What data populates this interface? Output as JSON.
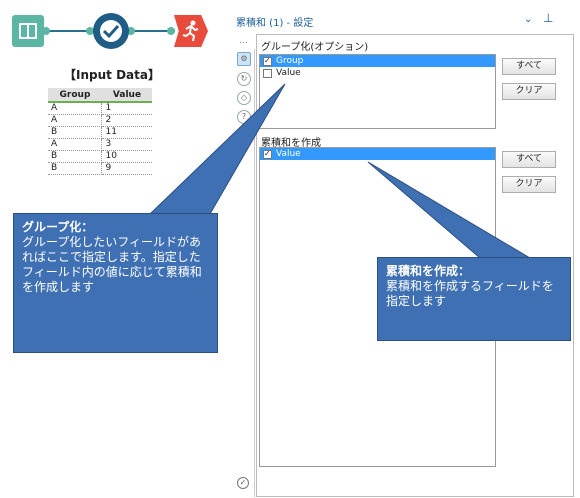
{
  "workflow": {
    "tools": [
      {
        "icon": "input-data-book-icon"
      },
      {
        "icon": "running-total-check-icon"
      },
      {
        "icon": "output-runner-icon"
      }
    ]
  },
  "input_table": {
    "title": "【Input Data】",
    "headers": [
      "Group",
      "Value"
    ],
    "rows": [
      [
        "A",
        "1"
      ],
      [
        "A",
        "2"
      ],
      [
        "B",
        "11"
      ],
      [
        "A",
        "3"
      ],
      [
        "B",
        "10"
      ],
      [
        "B",
        "9"
      ]
    ]
  },
  "panel": {
    "title": "累積和 (1) - 設定",
    "collapse_icon": "chevron-down-icon",
    "pin_icon": "pin-icon",
    "dots": "…",
    "group_section": {
      "label": "グループ化(オプション)",
      "items": [
        {
          "label": "Group",
          "checked": true,
          "selected": true
        },
        {
          "label": "Value",
          "checked": false,
          "selected": false
        }
      ],
      "all_button": "すべて",
      "clear_button": "クリア"
    },
    "running_section": {
      "label": "累積和を作成",
      "items": [
        {
          "label": "Value",
          "checked": true,
          "selected": true
        }
      ],
      "all_button": "すべて",
      "clear_button": "クリア"
    }
  },
  "callouts": {
    "group": {
      "title": "グループ化：",
      "body": "グループ化したいフィールドがあればここで指定します。指定したフィールド内の値に応じて累積和を作成します"
    },
    "running": {
      "title": "累積和を作成：",
      "body": "累積和を作成するフィールドを指定します"
    }
  },
  "colors": {
    "accent": "#1f5f9c",
    "callout": "#3f70b4",
    "selection": "#3399ff"
  }
}
